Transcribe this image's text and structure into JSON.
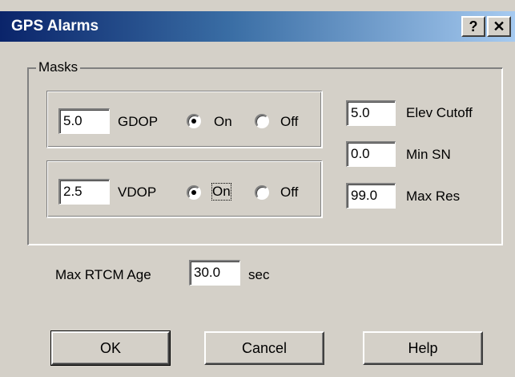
{
  "window": {
    "title": "GPS Alarms",
    "help_button": "?",
    "close_button": "✕"
  },
  "masks": {
    "legend": "Masks",
    "gdop": {
      "value": "5.0",
      "label": "GDOP",
      "on_label": "On",
      "off_label": "Off",
      "selected": "On"
    },
    "vdop": {
      "value": "2.5",
      "label": "VDOP",
      "on_label": "On",
      "off_label": "Off",
      "selected": "On"
    },
    "elev_cutoff": {
      "value": "5.0",
      "label": "Elev Cutoff"
    },
    "min_sn": {
      "value": "0.0",
      "label": "Min SN"
    },
    "max_res": {
      "value": "99.0",
      "label": "Max Res"
    }
  },
  "rtcm": {
    "label": "Max RTCM Age",
    "value": "30.0",
    "unit": "sec"
  },
  "buttons": {
    "ok": "OK",
    "cancel": "Cancel",
    "help": "Help"
  },
  "colors": {
    "face": "#d4d0c8",
    "title_start": "#0a246a",
    "title_end": "#a6caf0"
  }
}
